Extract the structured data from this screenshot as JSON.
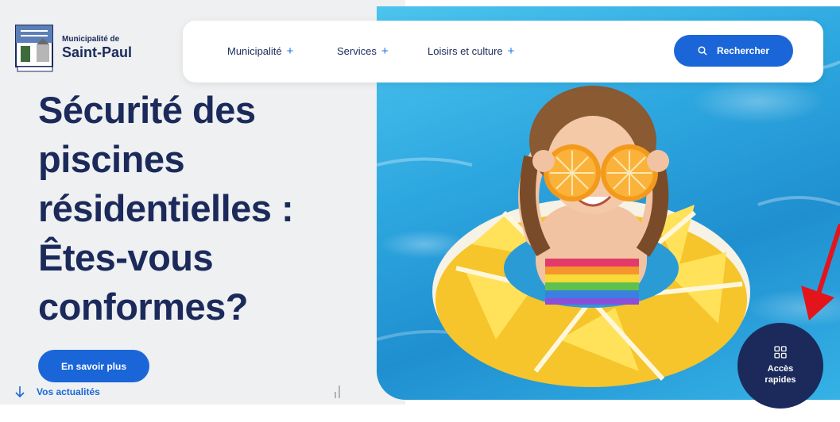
{
  "brand": {
    "small_label": "Municipalité de",
    "name": "Saint-Paul",
    "crest_icon": "municipal-crest"
  },
  "nav": {
    "items": [
      {
        "label": "Municipalité"
      },
      {
        "label": "Services"
      },
      {
        "label": "Loisirs et culture"
      }
    ],
    "plus_symbol": "+",
    "search_label": "Rechercher"
  },
  "hero": {
    "title_lines": [
      "Sécurité des",
      "piscines",
      "résidentielles :",
      "Êtes-vous",
      "conformes?"
    ],
    "cta_label": "En savoir plus",
    "news_label": "Vos actualités",
    "photo": "child-in-lemon-pool-float"
  },
  "quick_access": {
    "line1": "Accès",
    "line2": "rapides",
    "icon": "grid-icon"
  },
  "colors": {
    "navy": "#1b2a5b",
    "accent_blue": "#1a66d9",
    "annotation_red": "#e3141b"
  }
}
